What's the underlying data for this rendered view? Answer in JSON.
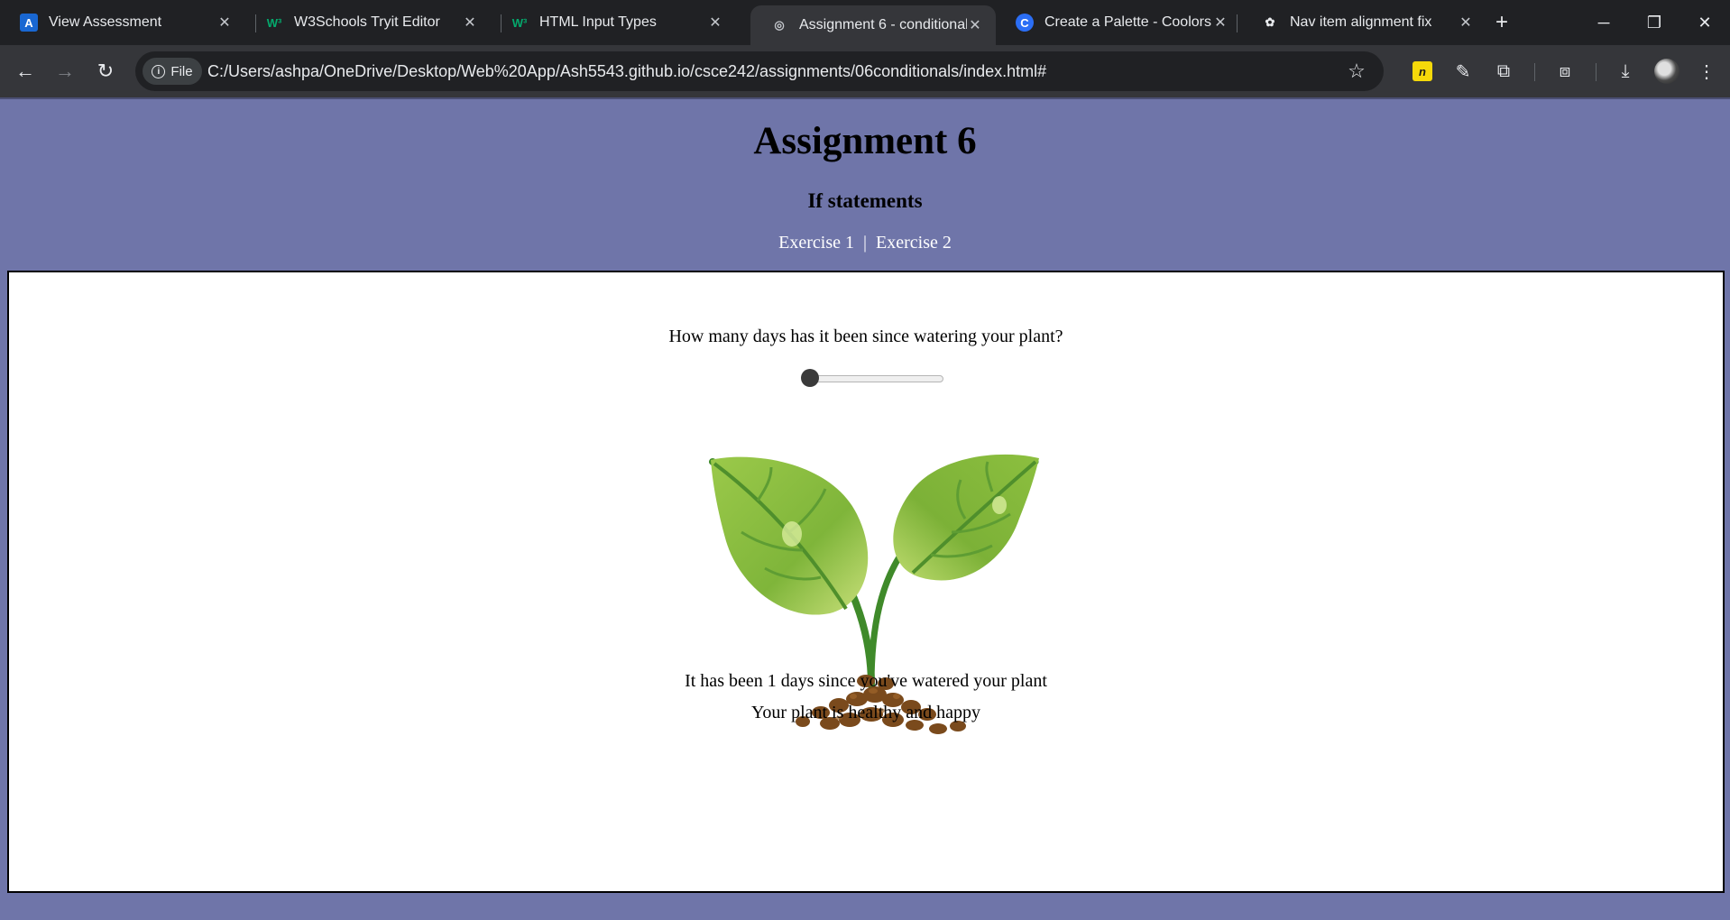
{
  "browser": {
    "tabs": [
      {
        "label": "View Assessment",
        "favicon": "A",
        "favicon_name": "assessment-favicon",
        "active": false
      },
      {
        "label": "W3Schools Tryit Editor",
        "favicon": "W³",
        "favicon_name": "w3schools-favicon",
        "active": false
      },
      {
        "label": "HTML Input Types",
        "favicon": "W³",
        "favicon_name": "w3schools-favicon",
        "active": false
      },
      {
        "label": "Assignment 6 - conditionals",
        "favicon": "◎",
        "favicon_name": "globe-icon",
        "active": true
      },
      {
        "label": "Create a Palette - Coolors",
        "favicon": "C",
        "favicon_name": "coolors-favicon",
        "active": false
      },
      {
        "label": "Nav item alignment fix",
        "favicon": "✿",
        "favicon_name": "chatgpt-favicon",
        "active": false
      }
    ],
    "new_tab_glyph": "+",
    "window_controls": {
      "minimize": "─",
      "restore": "❐",
      "close": "✕"
    },
    "nav": {
      "back": "←",
      "forward": "→",
      "reload": "↻"
    },
    "omnibox": {
      "chip_label": "File",
      "url": "C:/Users/ashpa/OneDrive/Desktop/Web%20App/Ash5543.github.io/csce242/assignments/06conditionals/index.html#"
    },
    "toolbar_icons": {
      "star": "☆",
      "extension_badge": "n",
      "eyedropper": "✎",
      "puzzle": "⧉",
      "cast": "⧈",
      "download": "⤓",
      "menu": "⋮"
    }
  },
  "page": {
    "title": "Assignment 6",
    "subtitle": "If statements",
    "nav_links": [
      {
        "label": "Exercise 1"
      },
      {
        "label": "Exercise 2"
      }
    ],
    "nav_separator": "|",
    "question": "How many days has it been since watering your plant?",
    "slider": {
      "value": 1,
      "min": 1,
      "max": 12
    },
    "days_message": "It has been 1 days since you've watered your plant",
    "plant_status": "Your plant is healthy and happy"
  },
  "colors": {
    "page_background": "#6f75a9",
    "content_background": "#ffffff",
    "leaf_green": "#8dc045",
    "stem_green": "#3f8a2a",
    "soil_brown": "#7a4a1c"
  }
}
